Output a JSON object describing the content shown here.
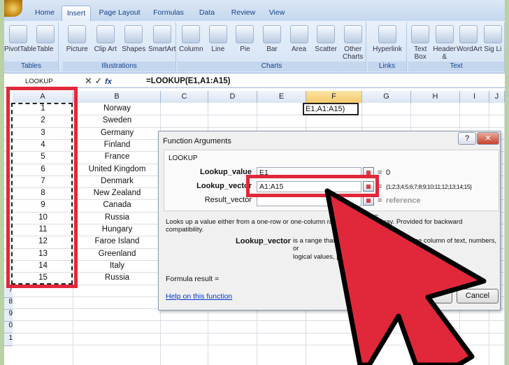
{
  "ribbon": {
    "tabs": [
      "Home",
      "Insert",
      "Page Layout",
      "Formulas",
      "Data",
      "Review",
      "View"
    ],
    "active_tab": "Insert",
    "groups": [
      {
        "label": "Tables",
        "buttons": [
          "PivotTable",
          "Table"
        ]
      },
      {
        "label": "Illustrations",
        "buttons": [
          "Picture",
          "Clip Art",
          "Shapes",
          "SmartArt"
        ]
      },
      {
        "label": "Charts",
        "buttons": [
          "Column",
          "Line",
          "Pie",
          "Bar",
          "Area",
          "Scatter",
          "Other Charts"
        ]
      },
      {
        "label": "Links",
        "buttons": [
          "Hyperlink"
        ]
      },
      {
        "label": "Text",
        "buttons": [
          "Text Box",
          "Header & Footer",
          "WordArt",
          "Sig Li"
        ]
      }
    ]
  },
  "formula_bar": {
    "name_box": "LOOKUP",
    "cancel": "✕",
    "enter": "✓",
    "fx": "fx",
    "formula": "=LOOKUP(E1,A1:A15)"
  },
  "grid": {
    "columns": [
      "A",
      "B",
      "C",
      "D",
      "E",
      "F",
      "G",
      "H",
      "I",
      "J"
    ],
    "selected_column": "F",
    "rows": [
      [
        "1",
        "Norway"
      ],
      [
        "2",
        "Sweden"
      ],
      [
        "3",
        "Germany"
      ],
      [
        "4",
        "Finland"
      ],
      [
        "5",
        "France"
      ],
      [
        "6",
        "United Kingdom"
      ],
      [
        "7",
        "Denmark"
      ],
      [
        "8",
        "New Zealand"
      ],
      [
        "9",
        "Canada"
      ],
      [
        "10",
        "Russia"
      ],
      [
        "11",
        "Hungary"
      ],
      [
        "12",
        "Faroe Island"
      ],
      [
        "13",
        "Greenland"
      ],
      [
        "14",
        "Italy"
      ],
      [
        "15",
        "Russia"
      ]
    ],
    "edit_cell": "E1,A1:A15)",
    "row_numbers_below": [
      "7",
      "8",
      "9",
      "0",
      "1"
    ]
  },
  "dialog": {
    "title": "Function Arguments",
    "help_btn": "?",
    "close_btn": "✕",
    "function": "LOOKUP",
    "args": [
      {
        "label": "Lookup_value",
        "value": "E1",
        "result": "0"
      },
      {
        "label": "Lookup_vector",
        "value": "A1:A15",
        "result": "{1;2;3;4;5;6;7;8;9;10;11;12;13;14;15}"
      },
      {
        "label": "Result_vector",
        "value": "",
        "result": "reference"
      }
    ],
    "eq": "=",
    "description": "Looks up a value either from a one-row or one-column range or from an array. Provided for backward compatibility.",
    "arg_name": "Lookup_vector",
    "arg_desc1": "is a range that contains only one row or one column of text, numbers, or",
    "arg_desc2": "logical values, placed in ascending order.",
    "formula_result": "Formula result =",
    "help_link": "Help on this function",
    "ok": "OK",
    "cancel": "Cancel"
  },
  "colors": {
    "highlight": "#e0283a",
    "arrow": "#e0283a",
    "frame": "#b9d1a4"
  }
}
